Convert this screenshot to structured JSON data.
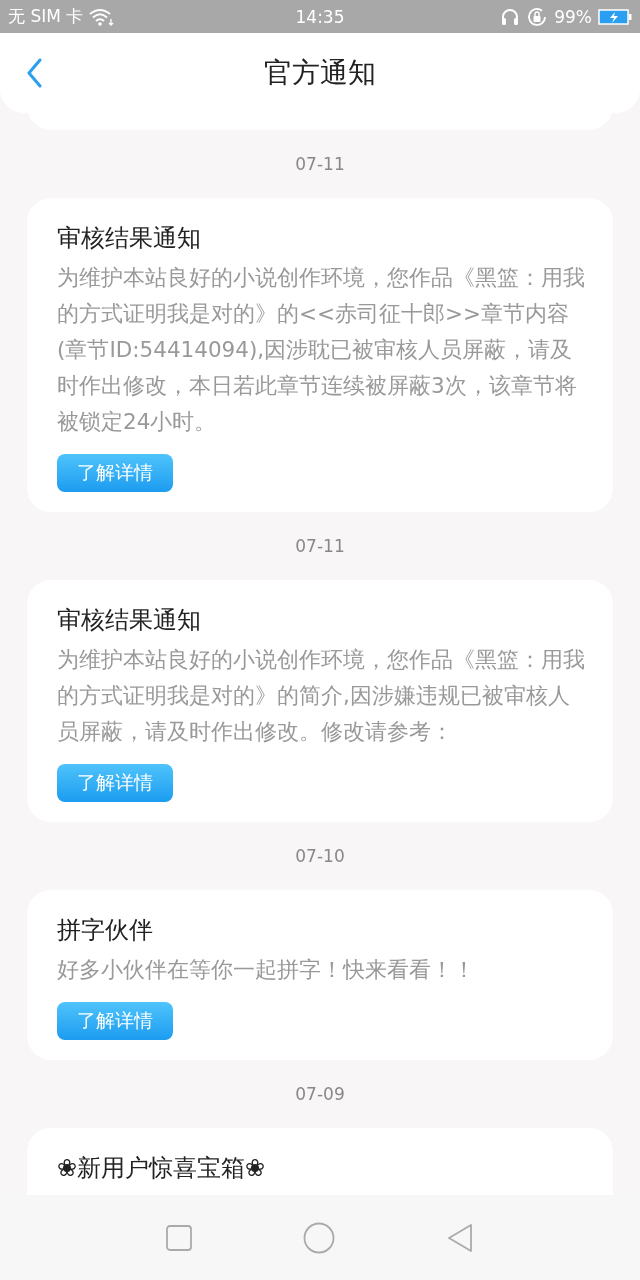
{
  "status_bar": {
    "carrier": "无 SIM 卡",
    "time": "14:35",
    "battery": "99%"
  },
  "header": {
    "title": "官方通知"
  },
  "notifications": [
    {
      "date": "07-11",
      "title": "审核结果通知",
      "body": "为维护本站良好的小说创作环境，您作品《黑篮：用我的方式证明我是对的》的<<赤司征十郎>>章节内容(章节ID:54414094),因涉耽已被审核人员屏蔽，请及时作出修改，本日若此章节连续被屏蔽3次，该章节将被锁定24小时。",
      "button": "了解详情"
    },
    {
      "date": "07-11",
      "title": "审核结果通知",
      "body": "为维护本站良好的小说创作环境，您作品《黑篮：用我的方式证明我是对的》的简介,因涉嫌违规已被审核人员屏蔽，请及时作出修改。修改请参考：",
      "button": "了解详情"
    },
    {
      "date": "07-10",
      "title": "拼字伙伴",
      "body": "好多小伙伴在等你一起拼字！快来看看！！",
      "button": "了解详情"
    },
    {
      "date": "07-09",
      "title": "❀新用户惊喜宝箱❀"
    }
  ]
}
